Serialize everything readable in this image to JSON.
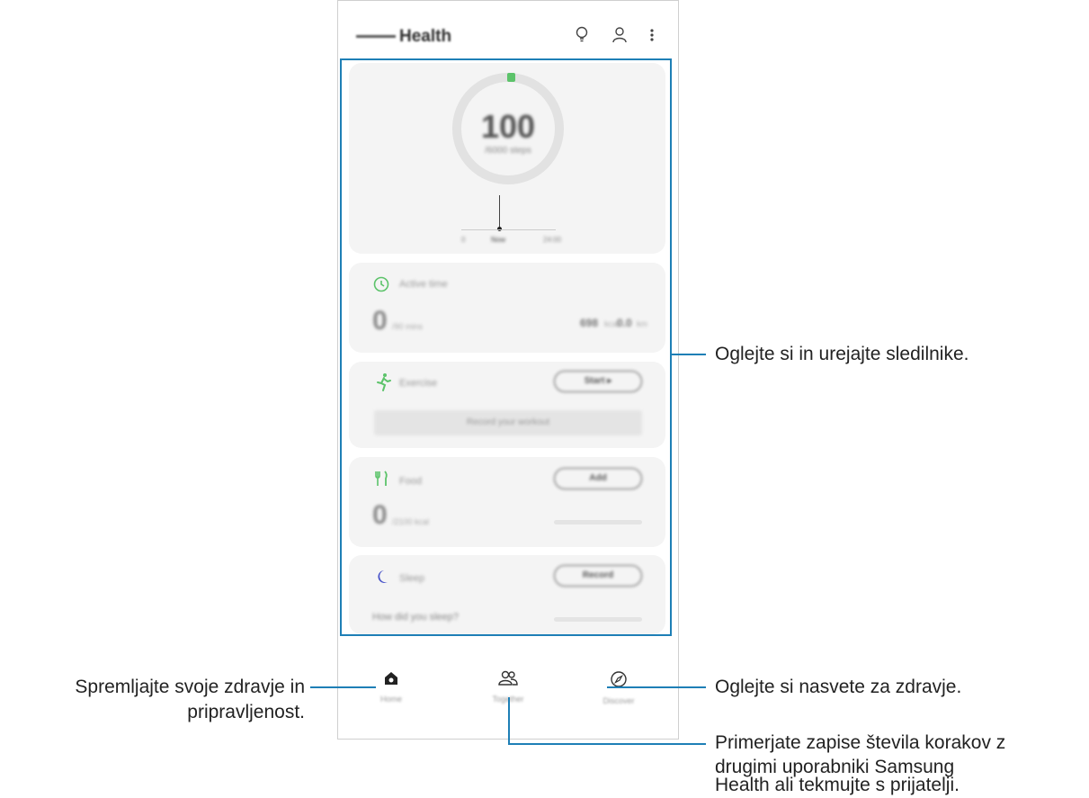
{
  "app": {
    "title": "Health"
  },
  "toolbar": {
    "tips_icon": "lightbulb-icon",
    "profile_icon": "person-icon",
    "more_icon": "more-vert-icon"
  },
  "steps": {
    "count": "100",
    "goal": "/6000 steps",
    "chart_labels": [
      "0",
      "Now",
      "24:00"
    ]
  },
  "active_time": {
    "label": "Active time",
    "value": "0",
    "unit": "/90 mins",
    "cal": "698",
    "cal_unit": "kcal",
    "dist": "0.0",
    "dist_unit": "km"
  },
  "exercise": {
    "label": "Exercise",
    "start_label": "Start ▸",
    "record_label": "Record your workout"
  },
  "food": {
    "label": "Food",
    "add_label": "Add",
    "value": "0",
    "unit": "/2100 kcal"
  },
  "sleep": {
    "label": "Sleep",
    "record_label": "Record",
    "question": "How did you sleep?"
  },
  "nav": {
    "home": "Home",
    "together": "Together",
    "discover": "Discover"
  },
  "annotations": {
    "trackers": "Oglejte si in urejajte sledilnike.",
    "home_line1": "Spremljajte svoje zdravje in",
    "home_line2": "pripravljenost.",
    "discover": "Oglejte si nasvete za zdravje.",
    "together_line1": "Primerjate zapise števila korakov z",
    "together_line2": "drugimi uporabniki Samsung",
    "together_line3": "Health ali tekmujte s prijatelji."
  },
  "colors": {
    "accent": "#1e7fb6",
    "green": "#5cc36a",
    "sleep_blue": "#4a55c9"
  }
}
